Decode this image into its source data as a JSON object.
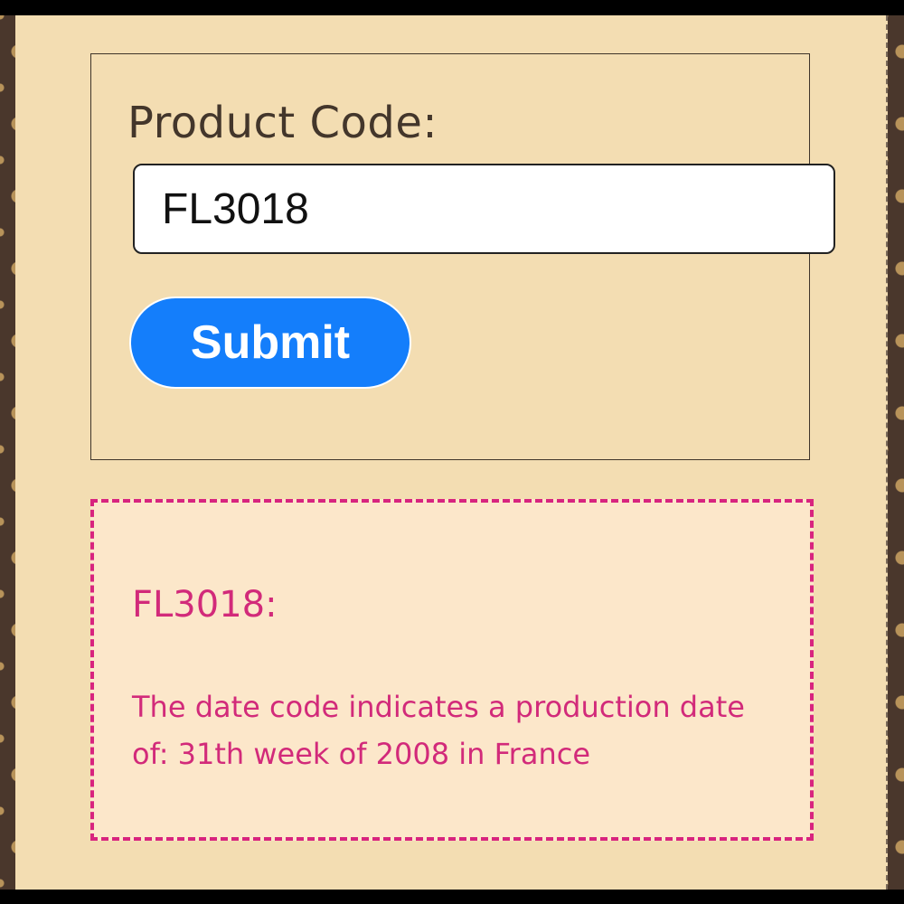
{
  "form": {
    "label": "Product Code:",
    "input_value": "FL3018",
    "submit_label": "Submit"
  },
  "result": {
    "title": "FL3018:",
    "text": "The date code indicates a production date of: 31th week of 2008 in France"
  },
  "colors": {
    "panel_bg": "#f3ddb2",
    "submit_bg": "#147efb",
    "result_accent": "#d22a7a",
    "result_bg": "#fce7ca",
    "frame_brown": "#4a372c"
  }
}
